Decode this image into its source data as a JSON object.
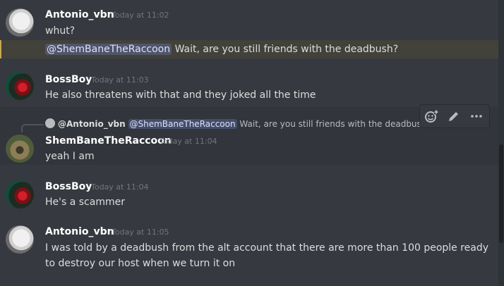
{
  "messages": [
    {
      "author": "Antonio_vbn",
      "timestamp": "Today at 11:02",
      "lines": [
        "whut?"
      ],
      "followup": {
        "mention": "@ShemBaneTheRaccoon",
        "text": " Wait, are you still friends with the deadbush?"
      }
    },
    {
      "author": "BossBoy",
      "timestamp": "Today at 11:03",
      "lines": [
        "He also threatens with that and they joked all the time"
      ]
    },
    {
      "reply": {
        "author": "@Antonio_vbn",
        "mention": "@ShemBaneTheRaccoon",
        "text": " Wait, are you still friends with the deadbush?"
      },
      "author": "ShemBaneTheRaccoon",
      "timestamp": "Today at 11:04",
      "lines": [
        "yeah I am"
      ]
    },
    {
      "author": "BossBoy",
      "timestamp": "Today at 11:04",
      "lines": [
        "He's a scammer"
      ]
    },
    {
      "author": "Antonio_vbn",
      "timestamp": "Today at 11:05",
      "lines": [
        "I was told by a deadbush from the alt account that there are more than 100 people ready",
        "to destroy our host when we turn it on"
      ]
    }
  ],
  "toolbar": {
    "add_reaction_icon": "add-reaction-icon",
    "edit_icon": "pencil-icon",
    "more_icon": "ellipsis-icon"
  },
  "colors": {
    "background": "#36393f",
    "highlight": "#42413a",
    "highlight_border": "#c9a84c",
    "mention_bg": "rgba(114,137,218,0.3)",
    "username": "#ffffff",
    "timestamp": "#72767d"
  }
}
